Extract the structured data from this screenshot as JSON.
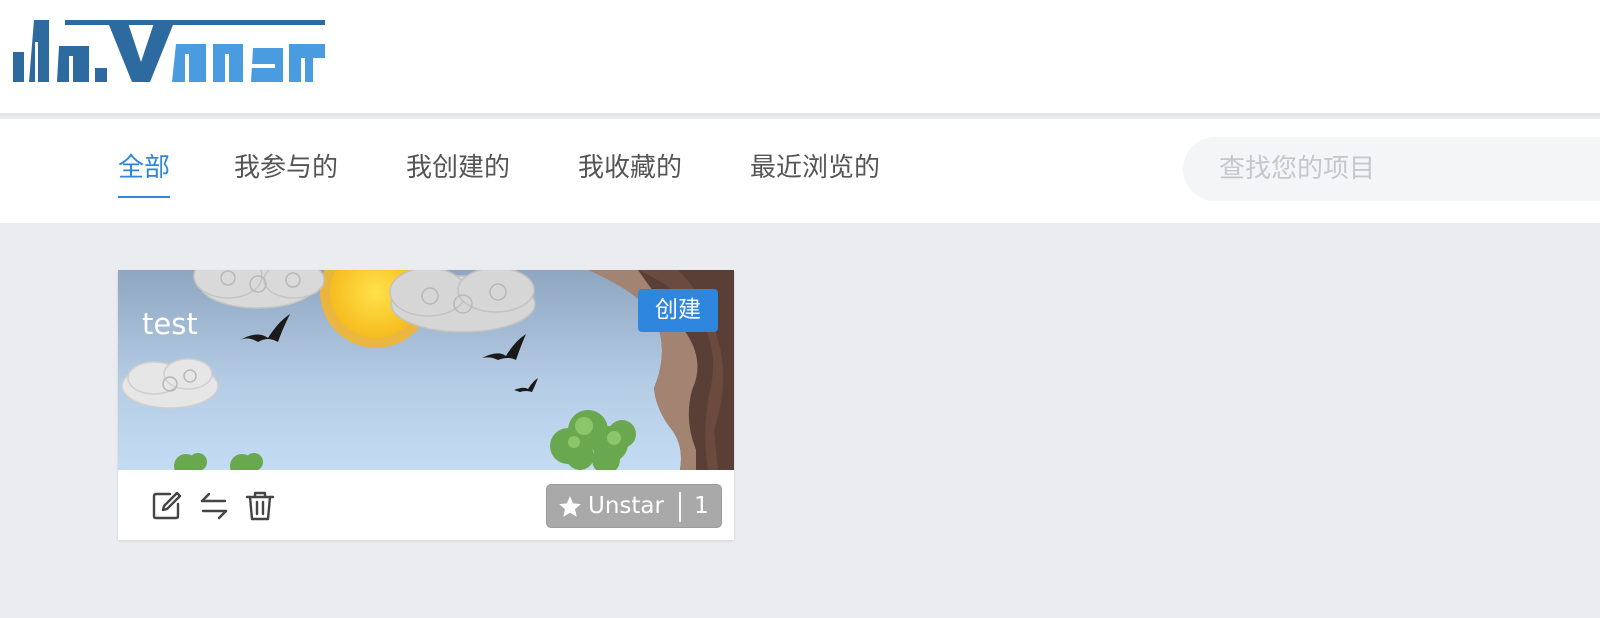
{
  "colors": {
    "accent": "#2e86de",
    "logo_dark": "#2d6a9f",
    "logo_light": "#4a9be0",
    "page_background": "#eaecf0",
    "star_button": "#a9a9a9"
  },
  "header": {
    "logo_text": "davinci"
  },
  "nav": {
    "tabs": [
      {
        "label": "全部",
        "active": true
      },
      {
        "label": "我参与的",
        "active": false
      },
      {
        "label": "我创建的",
        "active": false
      },
      {
        "label": "我收藏的",
        "active": false
      },
      {
        "label": "最近浏览的",
        "active": false
      }
    ]
  },
  "search": {
    "placeholder": "查找您的项目",
    "value": ""
  },
  "projects": [
    {
      "title": "test",
      "badge": "创建",
      "actions": [
        "edit-icon",
        "transfer-icon",
        "delete-icon"
      ],
      "star_label": "Unstar",
      "star_count": "1"
    }
  ]
}
